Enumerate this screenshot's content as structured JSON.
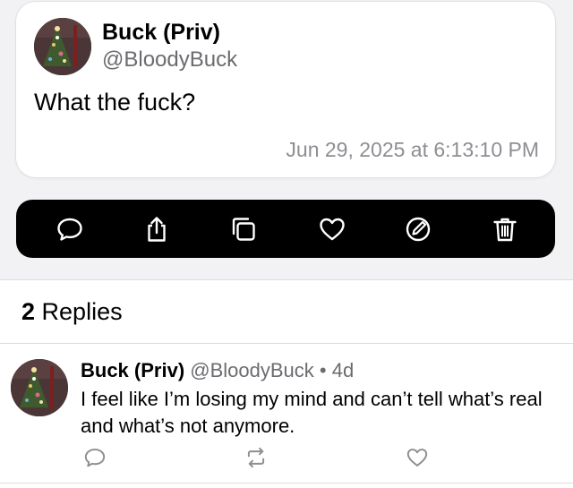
{
  "post": {
    "author_name": "Buck (Priv)",
    "author_handle": "@BloodyBuck",
    "text": "What the fuck?",
    "timestamp": "Jun 29, 2025 at 6:13:10 PM"
  },
  "actions": [
    {
      "icon": "reply-icon"
    },
    {
      "icon": "share-icon"
    },
    {
      "icon": "copy-icon"
    },
    {
      "icon": "heart-icon"
    },
    {
      "icon": "edit-icon"
    },
    {
      "icon": "trash-icon"
    }
  ],
  "replies": {
    "count": "2",
    "label": "Replies",
    "items": [
      {
        "author_name": "Buck (Priv)",
        "author_handle": "@BloodyBuck",
        "separator": "•",
        "age": "4d",
        "text": "I feel like I’m losing my mind and can’t tell what’s real and what’s not anymore."
      }
    ]
  },
  "colors": {
    "background": "#f2f2f4",
    "action_bar": "#000000",
    "secondary_text": "#6b6b70",
    "timestamp_text": "#8e8e93"
  }
}
